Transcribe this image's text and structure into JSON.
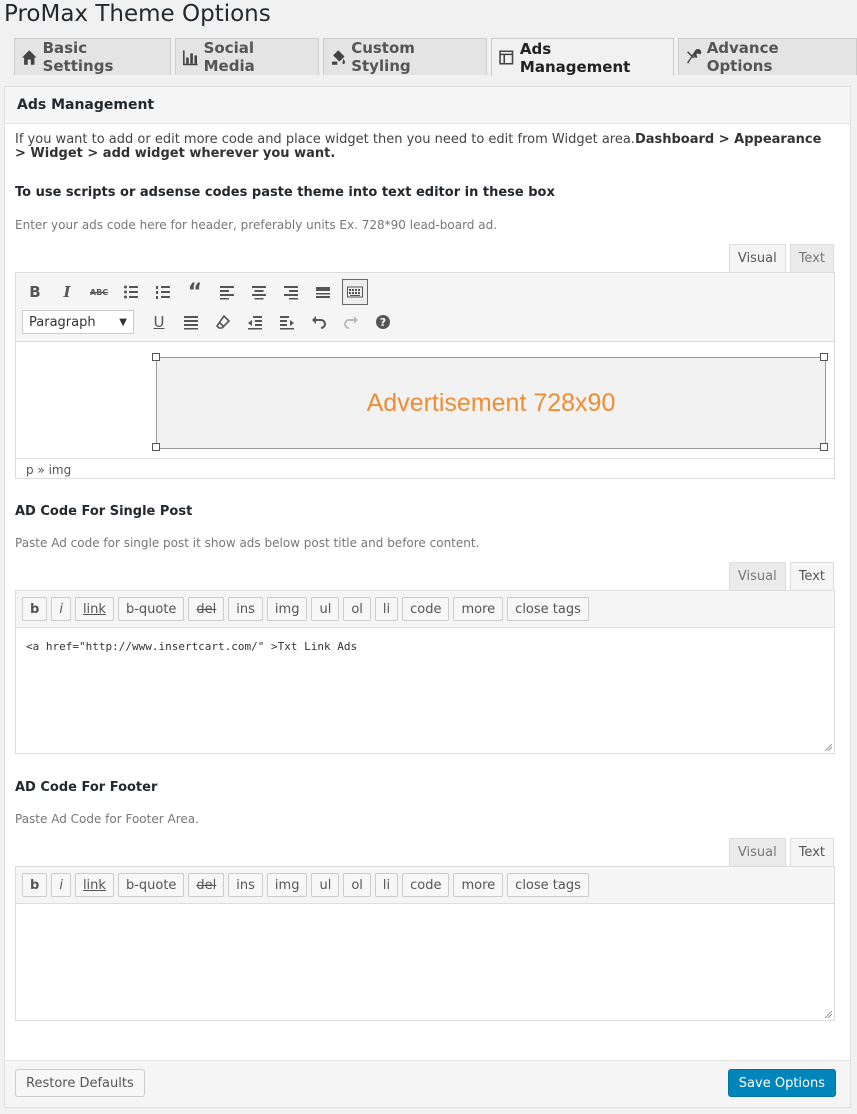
{
  "title": "ProMax Theme Options",
  "tabs": [
    {
      "label": "Basic Settings",
      "icon": "home-icon"
    },
    {
      "label": "Social Media",
      "icon": "chart-icon"
    },
    {
      "label": "Custom Styling",
      "icon": "paint-icon"
    },
    {
      "label": "Ads Management",
      "icon": "layout-icon",
      "active": true
    },
    {
      "label": "Advance Options",
      "icon": "tools-icon"
    }
  ],
  "panel": {
    "heading": "Ads Management",
    "intro_text": "If you want to add or edit more code and place widget then you need to edit from Widget area.",
    "intro_path": "Dashboard > Appearance > Widget > add widget wherever you want.",
    "scripts_title": "To use scripts or adsense codes paste theme into text editor in these box",
    "header_desc": "Enter your ads code here for header, preferably units Ex. 728*90 lead-board ad.",
    "mode_visual": "Visual",
    "mode_text": "Text",
    "format_select": "Paragraph",
    "ad_placeholder": "Advertisement 728x90",
    "status_path": "p » img",
    "single_title": "AD Code For Single Post",
    "single_desc": "Paste Ad code for single post it show ads below post title and before content.",
    "single_code": "<a href=\"http://www.insertcart.com/\" >Txt Link Ads",
    "footer_title": "AD Code For Footer",
    "footer_desc": "Paste Ad Code for Footer Area.",
    "footer_code": "",
    "quicktags": [
      "b",
      "i",
      "link",
      "b-quote",
      "del",
      "ins",
      "img",
      "ul",
      "ol",
      "li",
      "code",
      "more",
      "close tags"
    ]
  },
  "buttons": {
    "restore": "Restore Defaults",
    "save": "Save Options"
  },
  "colors": {
    "primary": "#0085ba",
    "ad_text": "#ee8d33"
  }
}
